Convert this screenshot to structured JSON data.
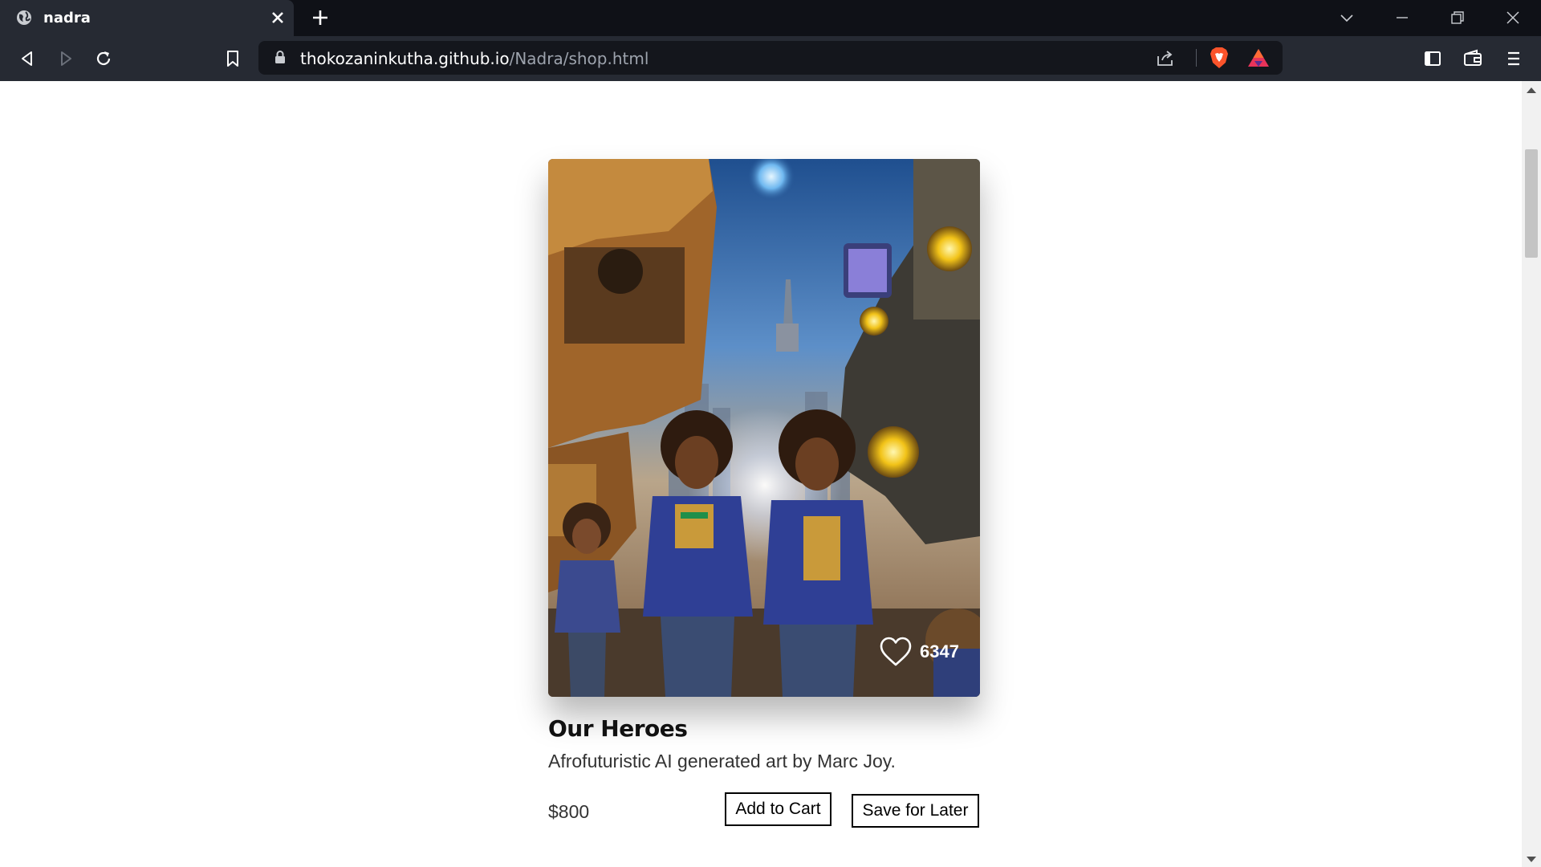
{
  "browser": {
    "tab_title": "nadra",
    "url_host": "thokozaninkutha.github.io",
    "url_path": "/Nadra/shop.html"
  },
  "product": {
    "title": "Our Heroes",
    "description": "Afrofuturistic AI generated art by Marc Joy.",
    "price": "$800",
    "likes": "6347",
    "add_to_cart_label": "Add to Cart",
    "save_for_later_label": "Save for Later"
  },
  "colors": {
    "chrome_dark": "#0f1117",
    "toolbar": "#262a33",
    "button_border": "#000000"
  }
}
